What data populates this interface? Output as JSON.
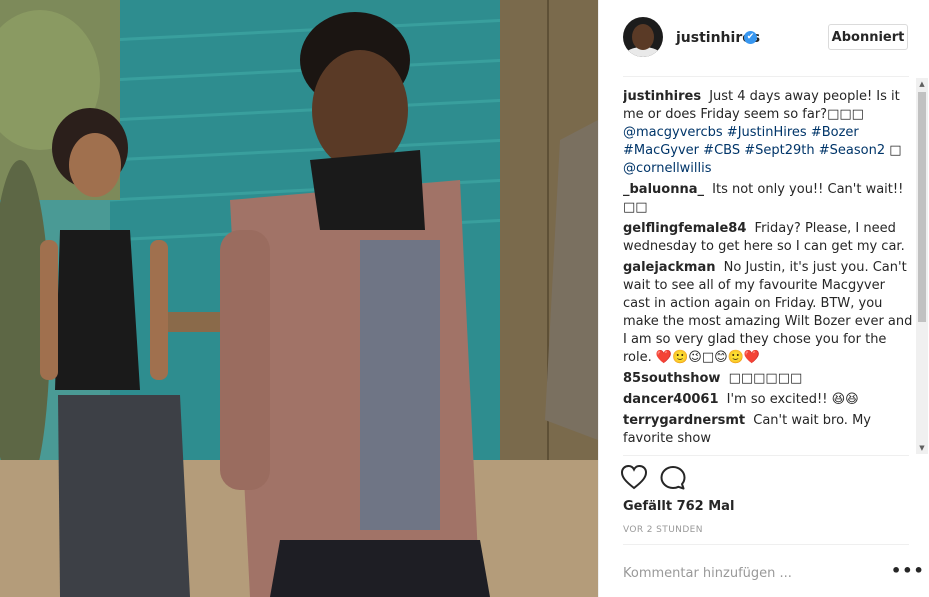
{
  "post": {
    "username": "justinhires",
    "verified_badge": "✔",
    "follow_button_label": "Abonniert",
    "likes_text": "Gefällt 762 Mal",
    "timestamp": "VOR 2 STUNDEN",
    "comment_placeholder": "Kommentar hinzufügen ...",
    "more_options": "•••",
    "photo_description_icon": "photo-image"
  },
  "caption": {
    "user": "justinhires",
    "text": "Just 4 days away people! Is it me or does Friday seem so far?",
    "emoji": "□□□",
    "tags": [
      "@macgyvercbs",
      "#JustinHires",
      "#Bozer",
      "#MacGyver",
      "#CBS",
      "#Sept29th",
      "#Season2"
    ],
    "tag_emoji": "□",
    "mention": "@cornellwillis"
  },
  "comments": [
    {
      "user": "_baluonna_",
      "text": "Its not only you!! Can't wait!! □□"
    },
    {
      "user": "gelflingfemale84",
      "text": "Friday? Please, I need wednesday to get here so I can get my car."
    },
    {
      "user": "galejackman",
      "text": "No Justin, it's just you. Can't wait to see all of my favourite Macgyver cast in action again on Friday. BTW, you make the most amazing Wilt Bozer ever and I am so very glad they chose you for the role. ❤️🙂😉□😊🙂❤️"
    },
    {
      "user": "85southshow",
      "text": "□□□□□□"
    },
    {
      "user": "dancer40061",
      "text": "I'm so excited!! 😆😆"
    },
    {
      "user": "terrygardnersmt",
      "text": "Can't wait bro. My favorite show"
    }
  ],
  "icons": {
    "like": "heart-icon",
    "comment": "comment-bubble-icon",
    "scroll_up": "▲",
    "scroll_down": "▼"
  },
  "colors": {
    "link": "#003569",
    "verified": "#3897f0",
    "text": "#262626",
    "muted": "#999999"
  }
}
